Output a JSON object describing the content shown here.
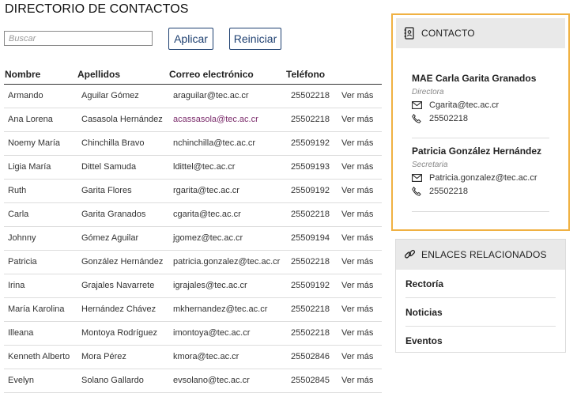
{
  "page": {
    "title": "DIRECTORIO DE CONTACTOS"
  },
  "filters": {
    "search_placeholder": "Buscar",
    "apply_label": "Aplicar",
    "reset_label": "Reiniciar"
  },
  "table": {
    "headers": {
      "name": "Nombre",
      "last": "Apellidos",
      "email": "Correo electrónico",
      "phone": "Teléfono"
    },
    "rows": [
      {
        "name": "Armando",
        "last": "Aguilar Gómez",
        "email": "araguilar@tec.ac.cr",
        "phone": "25502218",
        "more": "Ver más"
      },
      {
        "name": "Ana Lorena",
        "last": "Casasola Hernández",
        "email": "acassasola@tec.ac.cr",
        "phone": "25502218",
        "more": "Ver más"
      },
      {
        "name": "Noemy María",
        "last": "Chinchilla Bravo",
        "email": "nchinchilla@tec.ac.cr",
        "phone": "25509192",
        "more": "Ver más"
      },
      {
        "name": "Ligia María",
        "last": "Dittel Samuda",
        "email": "ldittel@tec.ac.cr",
        "phone": "25509193",
        "more": "Ver más"
      },
      {
        "name": "Ruth",
        "last": "Garita Flores",
        "email": "rgarita@tec.ac.cr",
        "phone": "25509192",
        "more": "Ver más"
      },
      {
        "name": "Carla",
        "last": "Garita Granados",
        "email": "cgarita@tec.ac.cr",
        "phone": "25502218",
        "more": "Ver más"
      },
      {
        "name": "Johnny",
        "last": "Gómez Aguilar",
        "email": "jgomez@tec.ac.cr",
        "phone": "25509194",
        "more": "Ver más"
      },
      {
        "name": "Patricia",
        "last": "González Hernández",
        "email": "patricia.gonzalez@tec.ac.cr",
        "phone": "25502218",
        "more": "Ver más"
      },
      {
        "name": "Irina",
        "last": "Grajales Navarrete",
        "email": "igrajales@tec.ac.cr",
        "phone": "25509192",
        "more": "Ver más"
      },
      {
        "name": "María Karolina",
        "last": "Hernández Chávez",
        "email": "mkhernandez@tec.ac.cr",
        "phone": "25502218",
        "more": "Ver más"
      },
      {
        "name": "Illeana",
        "last": "Montoya Rodríguez",
        "email": "imontoya@tec.ac.cr",
        "phone": "25502218",
        "more": "Ver más"
      },
      {
        "name": "Kenneth Alberto",
        "last": "Mora Pérez",
        "email": "kmora@tec.ac.cr",
        "phone": "25502846",
        "more": "Ver más"
      },
      {
        "name": "Evelyn",
        "last": "Solano Gallardo",
        "email": "evsolano@tec.ac.cr",
        "phone": "25502845",
        "more": "Ver más"
      }
    ]
  },
  "contact_panel": {
    "title": "CONTACTO",
    "people": [
      {
        "name": "MAE Carla Garita Granados",
        "role": "Directora",
        "email": "Cgarita@tec.ac.cr",
        "phone": "25502218"
      },
      {
        "name": "Patricia González Hernández",
        "role": "Secretaria",
        "email": "Patricia.gonzalez@tec.ac.cr",
        "phone": "25502218"
      }
    ]
  },
  "links_panel": {
    "title": "ENLACES RELACIONADOS",
    "items": [
      {
        "label": "Rectoría"
      },
      {
        "label": "Noticias"
      },
      {
        "label": "Eventos"
      }
    ]
  },
  "colors": {
    "accent_border": "#f0b142",
    "button": "#1d3f70",
    "panel_head": "#e9e9e9",
    "visited_link": "#7a2a6a"
  }
}
